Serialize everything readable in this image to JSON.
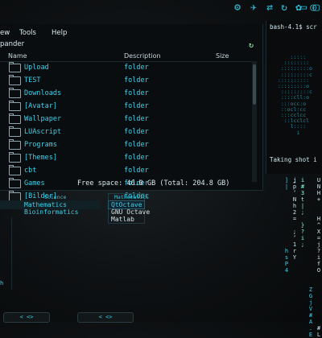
{
  "dock": {
    "icons": [
      "steam-icon",
      "bird-icon",
      "toggle-icon",
      "refresh-icon",
      "globe-icon",
      "chrome-icon",
      "chat-icon",
      "window-icon"
    ],
    "glyphs": [
      "⚙",
      "✈",
      "⇄",
      "↻",
      "✿",
      "◎",
      "▭",
      "▢"
    ]
  },
  "file_manager": {
    "menu": [
      "ew",
      "Tools",
      "Help"
    ],
    "path": "pander",
    "refresh_glyph": "↻",
    "columns": {
      "name": "Name",
      "description": "Description",
      "size": "Size"
    },
    "rows": [
      {
        "name": "Upload",
        "desc": "folder"
      },
      {
        "name": "TEST",
        "desc": "folder"
      },
      {
        "name": "Downloads",
        "desc": "folder"
      },
      {
        "name": "[Avatar]",
        "desc": "folder"
      },
      {
        "name": "Wallpaper",
        "desc": "folder"
      },
      {
        "name": "LUAscript",
        "desc": "folder"
      },
      {
        "name": "Programs",
        "desc": "folder"
      },
      {
        "name": "[Themes]",
        "desc": "folder"
      },
      {
        "name": "cbt",
        "desc": "folder"
      },
      {
        "name": "Games",
        "desc": "folder"
      },
      {
        "name": "[Bilder]",
        "desc": "folder"
      }
    ],
    "status": "Free space: 46.0 GB (Total: 204.8 GB)"
  },
  "terminal": {
    "prompt": "bash-4.1$ scr",
    "art_lines": [
      "     :::::",
      "   ::::::::",
      "  :::::::::o",
      "  :::::::::c",
      " ::::::::::",
      " :::::::::o",
      "  :::::::::c",
      "  ::::cll:o",
      "  :::occ:o",
      "  ::ocl:cc",
      "  :::cclcc",
      "   ::lcclcl",
      "     l::::",
      "       i"
    ],
    "taking": "Taking shot i"
  },
  "menu_panel": {
    "col1_title": "Science",
    "col1_items": [
      "Mathematics",
      "Bioinformatics"
    ],
    "col2_title": "Mathematics",
    "col2_items": [
      "QtOctave",
      "GNU Octave",
      "Matlab"
    ]
  },
  "left_panel": {
    "text": "h"
  },
  "bottom_bar": {
    "pill1": "< <>",
    "pill2": "< <>"
  },
  "vertical_text": [
    "]\n|\n\n\n\n\n\n\n\n\n\nh\ns\nP\n4\n\n\n\n\n\n\n\n\n\n",
    "ʝ\np\nʼ\nN\nh\n2\n=\n\n;\nʼ\n1\nr\nY\n\n\n\n\n\n\n\n\n\n\n",
    "i\n#\n3\nt\n|\n;\n\n}\n?\ni\n;\n\n\n\n\n\n\n\n\n\n\n\n\n",
    "\n\n\n\n\n\n\n\n\n\n\n\n\n\n\n\n\nZ\nG\nj\nV\n#\nA\n.\nE",
    "U\nN\nH\n+\n\n\nH\n^\nX\n=\nj\n?\ni\nf\nO\n\n\n\n\n\n\n\n\n#\nL"
  ]
}
